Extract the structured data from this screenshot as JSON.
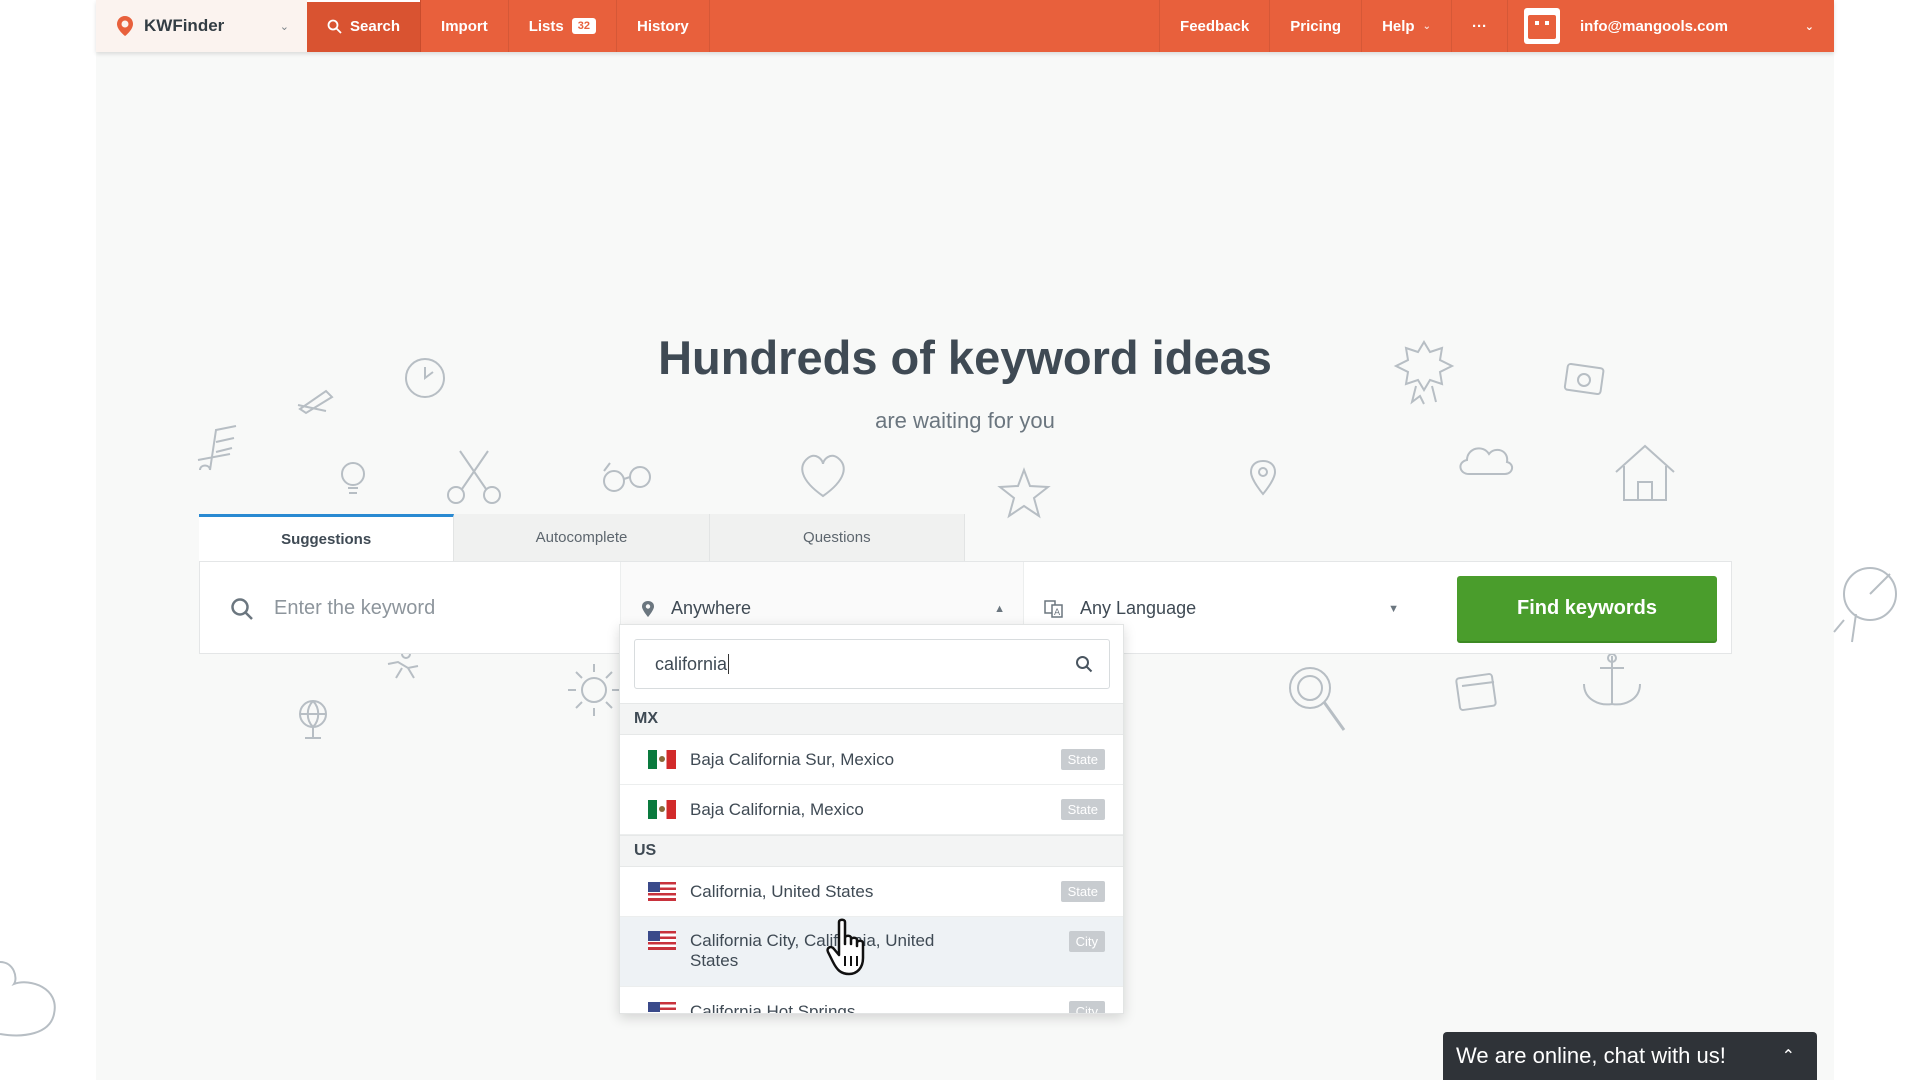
{
  "brand": {
    "name": "KWFinder"
  },
  "nav": {
    "search": "Search",
    "import": "Import",
    "lists": "Lists",
    "lists_count": "32",
    "history": "History",
    "feedback": "Feedback",
    "pricing": "Pricing",
    "help": "Help",
    "more": "···",
    "user_email": "info@mangools.com"
  },
  "hero": {
    "title": "Hundreds of keyword ideas",
    "subtitle": "are waiting for you"
  },
  "tabs": [
    "Suggestions",
    "Autocomplete",
    "Questions"
  ],
  "search": {
    "keyword_placeholder": "Enter the keyword",
    "location": "Anywhere",
    "language": "Any Language",
    "submit": "Find keywords"
  },
  "location_dropdown": {
    "query": "california",
    "groups": [
      {
        "code": "MX",
        "items": [
          {
            "label": "Baja California Sur, Mexico",
            "type": "State",
            "flag": "mx"
          },
          {
            "label": "Baja California, Mexico",
            "type": "State",
            "flag": "mx"
          }
        ]
      },
      {
        "code": "US",
        "items": [
          {
            "label": "California, United States",
            "type": "State",
            "flag": "us"
          },
          {
            "label": "California City, California, United States",
            "type": "City",
            "flag": "us"
          },
          {
            "label": "California Hot Springs",
            "type": "City",
            "flag": "us"
          }
        ]
      }
    ]
  },
  "chat": {
    "label": "We are online, chat with us!"
  },
  "colors": {
    "accent": "#e8603c",
    "primary_button": "#4a9d2c",
    "tab_active": "#2a8ad2"
  }
}
